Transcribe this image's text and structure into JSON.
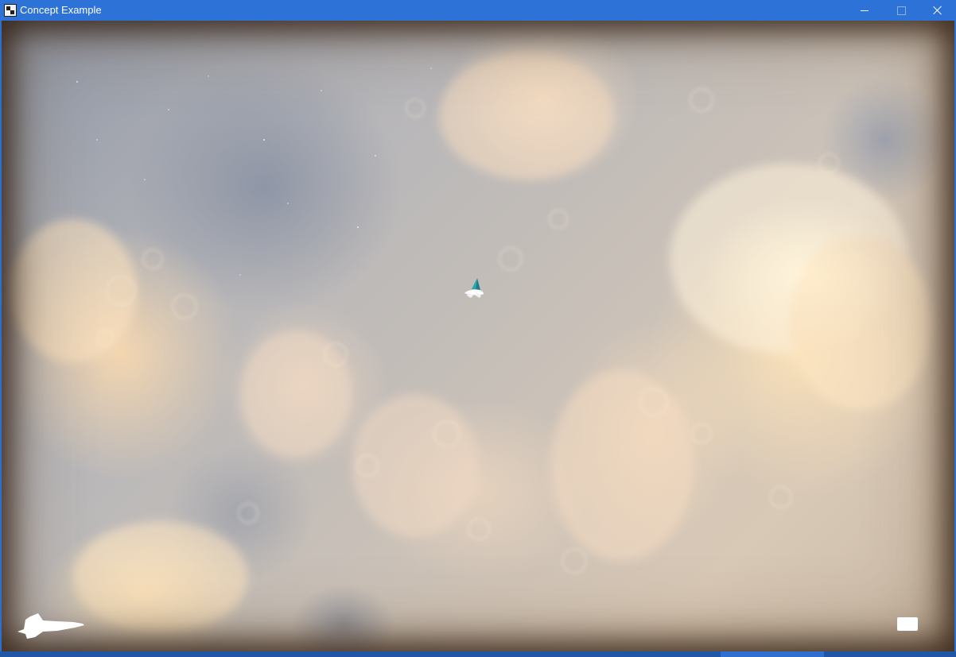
{
  "window": {
    "title": "Concept Example",
    "controls": {
      "minimize": "minimize-icon",
      "maximize": "maximize-icon",
      "close": "close-icon"
    },
    "titlebar_color": "#2d72d6"
  },
  "game": {
    "scene": "nebula-space-background",
    "player_ship": {
      "icon": "spaceship-icon",
      "color_primary": "#2aa7b0",
      "color_secondary": "#ffffff"
    },
    "hud": {
      "lives_icon": "shuttle-icon",
      "lives_color": "#ffffff",
      "status_indicator_icon": "status-box-icon"
    }
  }
}
